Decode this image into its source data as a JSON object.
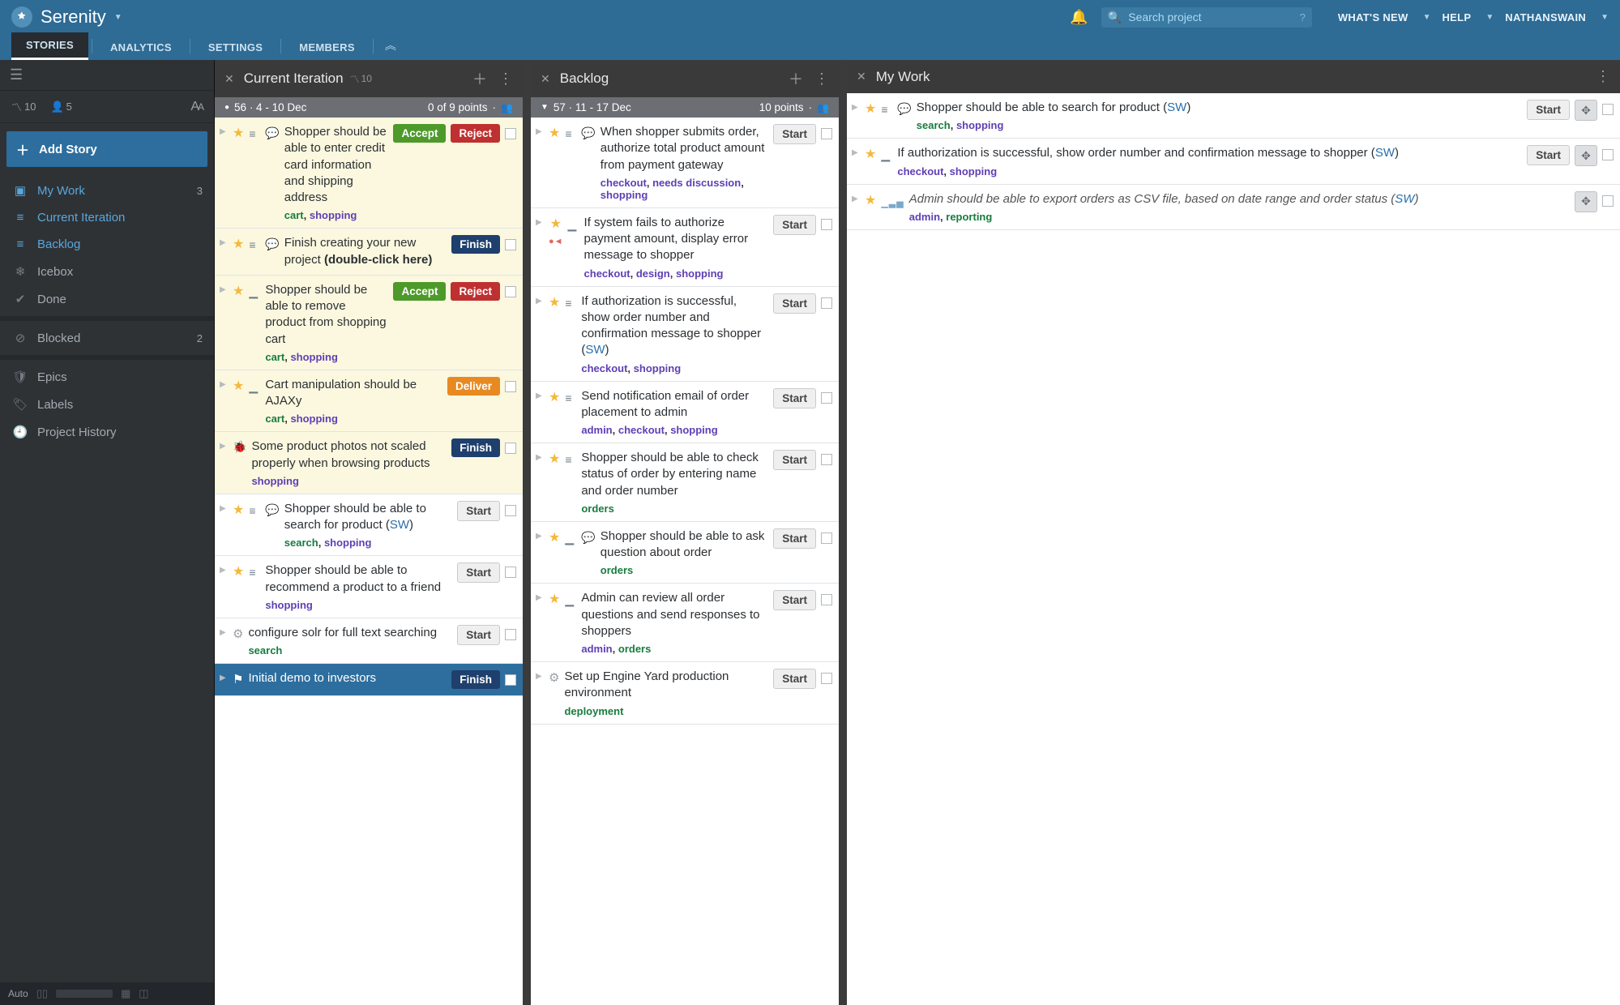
{
  "header": {
    "project_name": "Serenity",
    "search_placeholder": "Search project",
    "whats_new": "WHAT'S NEW",
    "help": "HELP",
    "username": "NATHANSWAIN"
  },
  "tabs": {
    "stories": "STORIES",
    "analytics": "ANALYTICS",
    "settings": "SETTINGS",
    "members": "MEMBERS"
  },
  "sidebar": {
    "velocity": "10",
    "members_count": "5",
    "add_story": "Add Story",
    "nav": {
      "my_work": "My Work",
      "my_work_count": "3",
      "current_iteration": "Current Iteration",
      "backlog": "Backlog",
      "icebox": "Icebox",
      "done": "Done",
      "blocked": "Blocked",
      "blocked_count": "2",
      "epics": "Epics",
      "labels": "Labels",
      "project_history": "Project History"
    },
    "footer_auto": "Auto"
  },
  "panels": {
    "current": {
      "title": "Current Iteration",
      "spark_val": "10",
      "iter_label": "56 · 4 - 10 Dec",
      "iter_points": "0 of 9 points"
    },
    "backlog": {
      "title": "Backlog",
      "iter_label": "57 · 11 - 17 Dec",
      "iter_points": "10 points"
    },
    "mywork": {
      "title": "My Work"
    }
  },
  "buttons": {
    "accept": "Accept",
    "reject": "Reject",
    "finish": "Finish",
    "deliver": "Deliver",
    "start": "Start"
  },
  "stories_current": [
    {
      "title": "Shopper should be able to enter credit card information and shipping address",
      "tags": "cart, shopping",
      "hl": true,
      "btns": [
        "accept",
        "reject"
      ],
      "cmt": true
    },
    {
      "title": "Finish creating your new project (double-click here)",
      "bold_tail": "(double-click here)",
      "hl": true,
      "btns": [
        "finish"
      ],
      "cmt": true
    },
    {
      "title": "Shopper should be able to remove product from shopping cart",
      "tags": "cart, shopping",
      "hl": true,
      "btns": [
        "accept",
        "reject"
      ],
      "est": "_"
    },
    {
      "title": "Cart manipulation should be AJAXy",
      "tags": "cart, shopping",
      "hl": true,
      "btns": [
        "deliver"
      ],
      "est": "_"
    },
    {
      "title": "Some product photos not scaled properly when browsing products",
      "tags": "shopping",
      "hl": true,
      "btns": [
        "finish"
      ],
      "bug": true
    },
    {
      "title_pre": "Shopper should be able to search for product (",
      "sw": "SW",
      "title_post": ")",
      "tags": "search, shopping",
      "btns": [
        "start"
      ],
      "cmt": true
    },
    {
      "title": "Shopper should be able to recommend a product to a friend",
      "tags": "shopping",
      "btns": [
        "start"
      ]
    },
    {
      "title": "configure solr for full text searching",
      "tags": "search",
      "btns": [
        "start"
      ],
      "gear": true
    },
    {
      "title": "Initial demo to investors",
      "btns": [
        "finish"
      ],
      "sel": true,
      "flag": true
    }
  ],
  "stories_backlog": [
    {
      "title": "When shopper submits order, authorize total product amount from payment gateway",
      "tags": "checkout, needs discussion, shopping",
      "btns": [
        "start"
      ],
      "cmt": true
    },
    {
      "title": "If system fails to authorize payment amount, display error message to shopper",
      "tags": "checkout, design, shopping",
      "btns": [
        "start"
      ],
      "est": "_",
      "blockers": true
    },
    {
      "title_pre": "If authorization is successful, show order number and confirmation message to shopper (",
      "sw": "SW",
      "title_post": ")",
      "tags": "checkout, shopping",
      "btns": [
        "start"
      ]
    },
    {
      "title": "Send notification email of order placement to admin",
      "tags": "admin, checkout, shopping",
      "btns": [
        "start"
      ]
    },
    {
      "title": "Shopper should be able to check status of order by entering name and order number",
      "tags": "orders",
      "btns": [
        "start"
      ]
    },
    {
      "title": "Shopper should be able to ask question about order",
      "tags": "orders",
      "btns": [
        "start"
      ],
      "cmt": true,
      "est": "_"
    },
    {
      "title": "Admin can review all order questions and send responses to shoppers",
      "tags": "admin, orders",
      "btns": [
        "start"
      ],
      "est": "_"
    },
    {
      "title": "Set up Engine Yard production environment",
      "tags": "deployment",
      "btns": [
        "start"
      ],
      "gear": true
    }
  ],
  "stories_mywork": [
    {
      "title_pre": "Shopper should be able to search for product (",
      "sw": "SW",
      "title_post": ")",
      "tags": "search, shopping",
      "btns": [
        "start"
      ],
      "move": true,
      "cmt": true
    },
    {
      "title_pre": "If authorization is successful, show order number and confirmation message to shopper (",
      "sw": "SW",
      "title_post": ")",
      "tags": "checkout, shopping",
      "btns": [
        "start"
      ],
      "move": true,
      "est": "_"
    },
    {
      "title_pre": "Admin should be able to export orders as CSV file, based on date range and order status (",
      "sw": "SW",
      "title_post": ")",
      "tags": "admin, reporting",
      "italic": true,
      "move_only": true,
      "est_tri": true
    }
  ]
}
